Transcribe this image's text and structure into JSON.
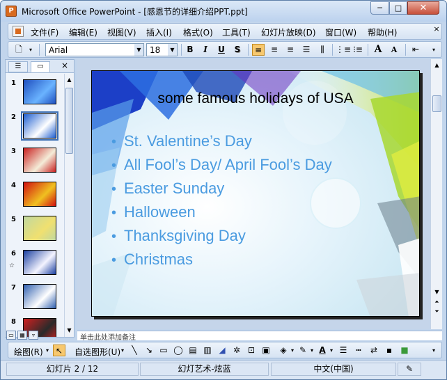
{
  "window": {
    "title": "Microsoft Office PowerPoint - [感恩节的详细介绍PPT.ppt]",
    "minimize_glyph": "─",
    "maximize_glyph": "□",
    "close_glyph": "✕"
  },
  "menubar": {
    "items": [
      "文件(F)",
      "编辑(E)",
      "视图(V)",
      "插入(I)",
      "格式(O)",
      "工具(T)",
      "幻灯片放映(D)",
      "窗口(W)",
      "帮助(H)"
    ],
    "close_glyph": "×"
  },
  "format_toolbar": {
    "font_name": "Arial",
    "font_size": "18",
    "bold": "B",
    "italic": "I",
    "underline": "U",
    "shadow": "S",
    "grow_font": "A",
    "shrink_font": "A"
  },
  "left_pane": {
    "close_glyph": "×",
    "selected_index": 1,
    "thumbnails": [
      {
        "number": "1",
        "colors": [
          "#1f4fbf",
          "#6ab3ff"
        ]
      },
      {
        "number": "2",
        "colors": [
          "#1e5fd0",
          "#ffffff"
        ]
      },
      {
        "number": "3",
        "colors": [
          "#c92020",
          "#f4ecd8"
        ]
      },
      {
        "number": "4",
        "colors": [
          "#d01010",
          "#f0c020"
        ]
      },
      {
        "number": "5",
        "colors": [
          "#c0d8a0",
          "#f0e070"
        ]
      },
      {
        "number": "6",
        "colors": [
          "#1a3fa0",
          "#f4f4ff"
        ]
      },
      {
        "number": "7",
        "colors": [
          "#3060b0",
          "#ffffff"
        ]
      },
      {
        "number": "8",
        "colors": [
          "#d02020",
          "#2a2a2a"
        ]
      }
    ]
  },
  "slide": {
    "title": "some famous holidays of USA",
    "bullets": [
      "St. Valentine’s Day",
      "All Fool’s Day/ April Fool’s Day",
      "Easter Sunday",
      "Halloween",
      "Thanksgiving Day",
      "Christmas"
    ],
    "bullet_color": "#4a9be0"
  },
  "notes": {
    "text": "单击此处添加备注"
  },
  "draw_toolbar": {
    "draw_label": "绘图(R)",
    "autoshapes_label": "自选图形(U)"
  },
  "statusbar": {
    "slide_position": "幻灯片 2 / 12",
    "design": "幻灯艺术-炫蓝",
    "language": "中文(中国)"
  },
  "colors": {
    "accent": "#4a9be0",
    "selection": "#3c6fb4",
    "toolbar_active": "#f7c86e"
  }
}
